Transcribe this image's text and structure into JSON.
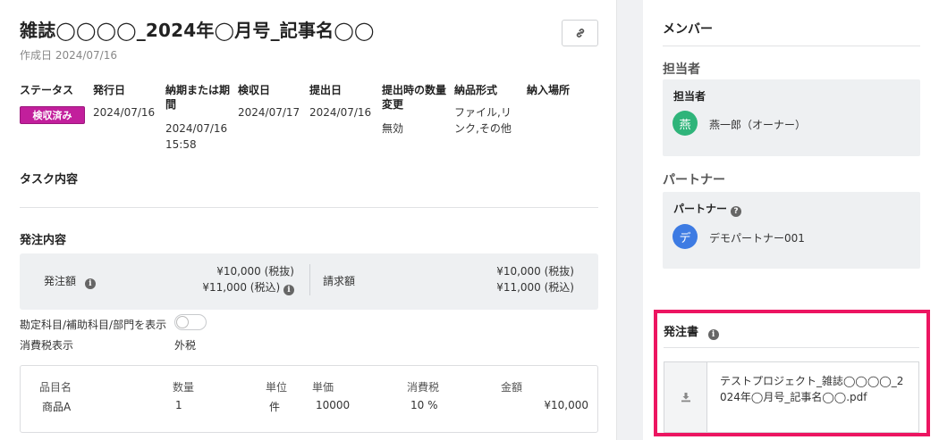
{
  "header": {
    "title": "雑誌◯◯◯◯_2024年◯月号_記事名◯◯",
    "created": "作成日 2024/07/16"
  },
  "info": {
    "columns": [
      {
        "label": "ステータス",
        "value": "検収済み"
      },
      {
        "label": "発行日",
        "value": "2024/07/16"
      },
      {
        "label": "納期または期間",
        "label_l1": "納期または期",
        "label_l2": "間",
        "value_l1": "",
        "value_l2": "2024/07/16",
        "value_l3": "15:58"
      },
      {
        "label": "検収日",
        "value": "2024/07/17"
      },
      {
        "label": "提出日",
        "value": "2024/07/16"
      },
      {
        "label_l1": "提出時の数量",
        "label_l2": "変更",
        "value": "無効"
      },
      {
        "label": "納品形式",
        "value_l1": "ファイル,リ",
        "value_l2": "ンク,その他"
      },
      {
        "label": "納入場所",
        "value": ""
      }
    ],
    "status_badge": "検収済み",
    "status_color": "#c21f9c"
  },
  "task": {
    "title": "タスク内容"
  },
  "order": {
    "title": "発注内容",
    "order_amount_label": "発注額",
    "order_excl": "¥10,000 (税抜)",
    "order_incl": "¥11,000 (税込)",
    "invoice_label": "請求額",
    "invoice_excl": "¥10,000 (税抜)",
    "invoice_incl": "¥11,000 (税込)",
    "account_toggle_label": "勘定科目/補助科目/部門を表示",
    "tax_display_label": "消費税表示",
    "tax_display_value": "外税"
  },
  "items": {
    "headers": [
      "品目名",
      "数量",
      "単位",
      "単価",
      "消費税",
      "金額"
    ],
    "rows": [
      [
        "商品A",
        "1",
        "件",
        "10000",
        "10 %",
        "¥10,000"
      ]
    ]
  },
  "sidebar": {
    "title": "メンバー",
    "assignee_section": "担当者",
    "assignee_head": "担当者",
    "assignee_avatar": "燕",
    "assignee_name": "燕一郎（オーナー）",
    "assignee_color": "#2fb47a",
    "partner_section": "パートナー",
    "partner_head": "パートナー",
    "partner_avatar": "デ",
    "partner_name": "デモパートナー001",
    "partner_color": "#3d7be3",
    "doc_title": "発注書",
    "doc_filename": "テストプロジェクト_雑誌◯◯◯◯_2024年◯月号_記事名◯◯.pdf",
    "highlight_color": "#ec1561"
  },
  "icons": [
    "link-icon",
    "info-icon",
    "question-icon",
    "download-icon"
  ]
}
